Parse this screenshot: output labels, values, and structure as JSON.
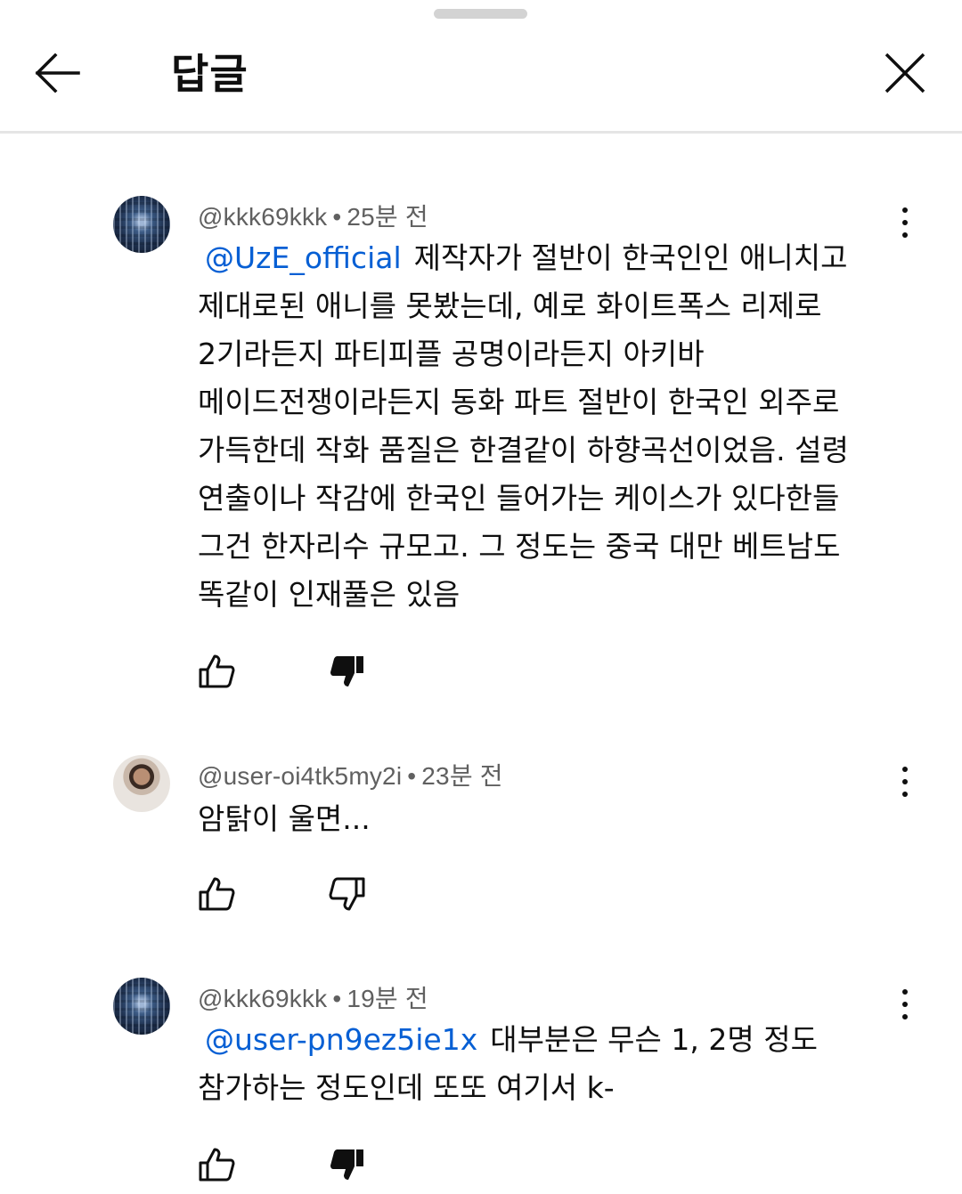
{
  "header": {
    "title": "답글",
    "back_icon": "arrow-left-icon",
    "close_icon": "close-icon"
  },
  "comments": [
    {
      "author": "@kkk69kkk",
      "separator": "•",
      "time": "25분 전",
      "mention": "@UzE_official",
      "text_first": "제작자가 절반이 한국인인 애니치고",
      "text_rest": "제대로된 애니를 못봤는데, 예로 화이트폭스 리제로\n2기라든지 파티피플 공명이라든지 아키바\n메이드전쟁이라든지 동화 파트 절반이 한국인 외주로\n가득한데 작화 품질은 한결같이 하향곡선이었음. 설령\n연출이나 작감에 한국인 들어가는 케이스가 있다한들\n그건 한자리수 규모고. 그 정도는 중국 대만 베트남도\n똑같이 인재풀은 있음",
      "avatar": "city-night-avatar",
      "like_icon": "thumbs-up-icon",
      "dislike_icon": "thumbs-down-filled-icon"
    },
    {
      "author": "@user-oi4tk5my2i",
      "separator": "•",
      "time": "23분 전",
      "text": "암탉이 울면...",
      "avatar": "person-avatar",
      "like_icon": "thumbs-up-icon",
      "dislike_icon": "thumbs-down-icon"
    },
    {
      "author": "@kkk69kkk",
      "separator": "•",
      "time": "19분 전",
      "mention": "@user-pn9ez5ie1x",
      "text_first": "대부분은 무슨 1, 2명 정도",
      "text_rest": "참가하는 정도인데 또또 여기서 k-",
      "avatar": "city-night-avatar",
      "like_icon": "thumbs-up-icon",
      "dislike_icon": "thumbs-down-filled-icon"
    }
  ],
  "colors": {
    "mention": "#065fd4",
    "meta": "#606060",
    "text": "#0f0f0f",
    "divider": "#e5e5e5"
  }
}
